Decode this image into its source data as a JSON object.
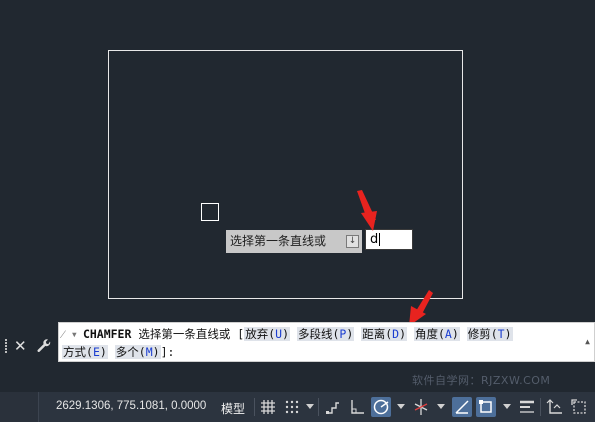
{
  "canvas": {
    "tooltip_text": "选择第一条直线或",
    "dynamic_input_value": "d"
  },
  "command_line": {
    "command": "CHAMFER",
    "prompt": "选择第一条直线或",
    "options": [
      {
        "label": "放弃",
        "key": "U"
      },
      {
        "label": "多段线",
        "key": "P"
      },
      {
        "label": "距离",
        "key": "D"
      },
      {
        "label": "角度",
        "key": "A"
      },
      {
        "label": "修剪",
        "key": "T"
      },
      {
        "label": "方式",
        "key": "E"
      },
      {
        "label": "多个",
        "key": "M"
      }
    ],
    "bracket_open": "[",
    "bracket_close": "]:",
    "key_open": "(",
    "key_close": ")"
  },
  "watermark": "软件自学网：RJZXW.COM",
  "status_bar": {
    "coordinates": "2629.1306, 775.1081, 0.0000",
    "model_tab": "模型",
    "icons": [
      "grid-icon",
      "snap-grid-icon",
      "ortho-icon",
      "infer-constraint-icon",
      "polar-tracking-icon",
      "isometric-icon",
      "object-snap-tracking-icon",
      "object-snap-icon",
      "lineweight-icon",
      "annotation-scale-icon",
      "workspace-icon"
    ]
  },
  "colors": {
    "canvas_background": "#212830",
    "annotation_arrow": "#e8231f",
    "option_key": "#1a3cd0",
    "status_active": "#4d6f9a"
  }
}
